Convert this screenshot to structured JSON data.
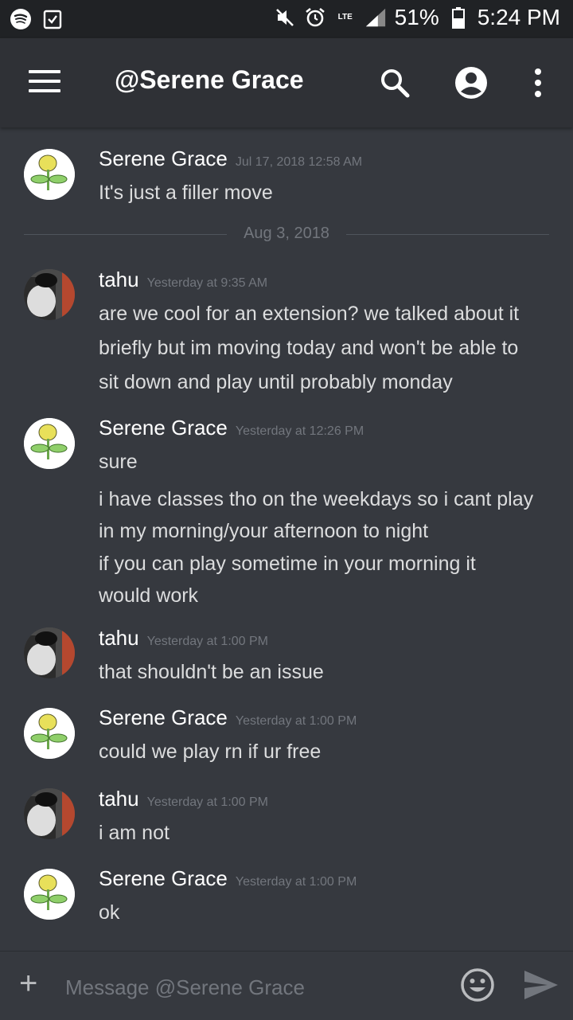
{
  "status_bar": {
    "battery": "51%",
    "time": "5:24 PM",
    "lte": "LTE"
  },
  "header": {
    "title": "@Serene Grace"
  },
  "date_divider": "Aug 3, 2018",
  "messages": [
    {
      "author": "Serene Grace",
      "timestamp": "Jul 17, 2018 12:58 AM",
      "lines": [
        "It's just a filler move"
      ]
    },
    {
      "author": "tahu",
      "timestamp": "Yesterday at 9:35 AM",
      "lines": [
        "are we cool for an extension? we talked about it",
        "briefly but im moving today and won't be able to",
        "sit down and play until probably monday"
      ]
    },
    {
      "author": "Serene Grace",
      "timestamp": "Yesterday at 12:26 PM",
      "lines": [
        "sure",
        "i have classes tho on the weekdays so i cant play",
        "in my morning/your afternoon to night",
        "if you can play sometime in your morning it",
        "would work"
      ]
    },
    {
      "author": "tahu",
      "timestamp": "Yesterday at 1:00 PM",
      "lines": [
        "that shouldn't be an issue"
      ]
    },
    {
      "author": "Serene Grace",
      "timestamp": "Yesterday at 1:00 PM",
      "lines": [
        "could we play rn if ur free"
      ]
    },
    {
      "author": "tahu",
      "timestamp": "Yesterday at 1:00 PM",
      "lines": [
        "i am not"
      ]
    },
    {
      "author": "Serene Grace",
      "timestamp": "Yesterday at 1:00 PM",
      "lines": [
        "ok"
      ]
    }
  ],
  "composer": {
    "placeholder": "Message @Serene Grace"
  },
  "icons": {
    "menu": "hamburger-menu-icon",
    "search": "search-icon",
    "profile": "account-circle-icon",
    "more": "more-vertical-icon",
    "add": "plus-icon",
    "emoji": "emoji-icon",
    "send": "send-icon"
  }
}
